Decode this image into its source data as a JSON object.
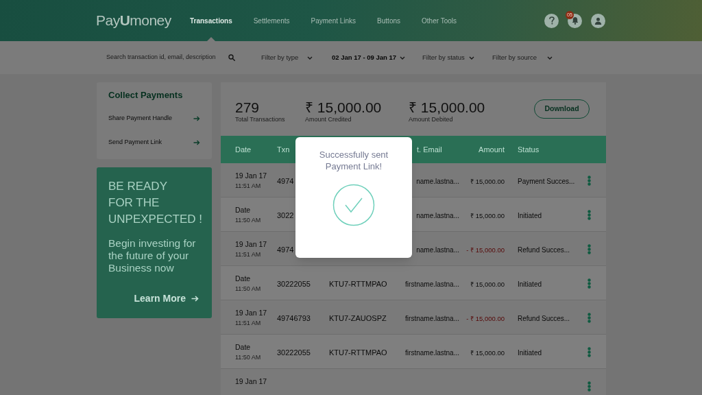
{
  "header": {
    "logo": "Pay**U**money",
    "nav": [
      {
        "label": "Transactions",
        "selected": true
      },
      {
        "label": "Settlements",
        "selected": false
      },
      {
        "label": "Payment Links",
        "selected": false
      },
      {
        "label": "Buttons",
        "selected": false
      },
      {
        "label": "Other Tools",
        "selected": false
      }
    ],
    "notification_badge": "05"
  },
  "filters": {
    "search": {
      "placeholder": "Search transaction id, email, description"
    },
    "dropdowns": [
      {
        "placeholder": "Filter by type"
      },
      {
        "value": "02 Jan 17 - 09 Jan 17"
      },
      {
        "placeholder": "Filter by status"
      },
      {
        "placeholder": "Filter by source"
      }
    ]
  },
  "collect_payments": {
    "title": "Collect Payments",
    "items": [
      "Share Payment Handle",
      "Send Payment Link"
    ]
  },
  "promo": {
    "heading_lines": [
      "BE READY",
      "FOR THE",
      "UNPEXPECTED !"
    ],
    "body": "Begin investing for the future of your Business now",
    "link": "Learn More"
  },
  "summary": {
    "stats": [
      {
        "value": "279",
        "label": "Total Transactions"
      },
      {
        "value": "₹ 15,000.00",
        "label": "Amount Credited"
      },
      {
        "value": "₹ 15,000.00",
        "label": "Amount Debited"
      }
    ],
    "download_button": "Download"
  },
  "table": {
    "columns": {
      "date": "Date",
      "txn_id": "Txn",
      "email": "t. Email",
      "amount": "Amount",
      "status": "Status"
    },
    "rows": [
      {
        "date": "19 Jan 17",
        "time": "11:51 AM",
        "txn_id": "4974",
        "email": "name.lastna...",
        "amount": "₹ 15,000.00",
        "debit": false,
        "status": "Payment Succes..."
      },
      {
        "date": "Date",
        "time": "11:50 AM",
        "txn_id": "3022",
        "email": "name.lastna...",
        "amount": "₹ 15,000.00",
        "debit": false,
        "status": "Initiated"
      },
      {
        "date": "19 Jan 17",
        "time": "11:51 AM",
        "txn_id": "4974",
        "email": "name.lastna...",
        "amount": "- ₹ 15,000.00",
        "debit": true,
        "status": "Refund Succes..."
      },
      {
        "date": "Date",
        "time": "11:50 AM",
        "txn_id": "30222055",
        "column_3": "KTU7-RTTMPAO",
        "email": "firstname.lastna...",
        "amount": "₹ 15,000.00",
        "debit": false,
        "status": "Initiated"
      },
      {
        "date": "19 Jan 17",
        "time": "11:51 AM",
        "txn_id": "49746793",
        "column_3": "KTU7-ZAUOSPZ",
        "email": "firstname.lastna...",
        "amount": "- ₹ 15,000.00",
        "debit": true,
        "status": "Refund Succes..."
      },
      {
        "date": "Date",
        "time": "11:50 AM",
        "txn_id": "30222055",
        "column_3": "KTU7-RTTMPAO",
        "email": "firstname.lastna...",
        "amount": "₹ 15,000.00",
        "debit": false,
        "status": "Initiated"
      },
      {
        "date": "19 Jan 17"
      }
    ]
  },
  "modal": {
    "message": "Successfully sent Payment Link!"
  }
}
